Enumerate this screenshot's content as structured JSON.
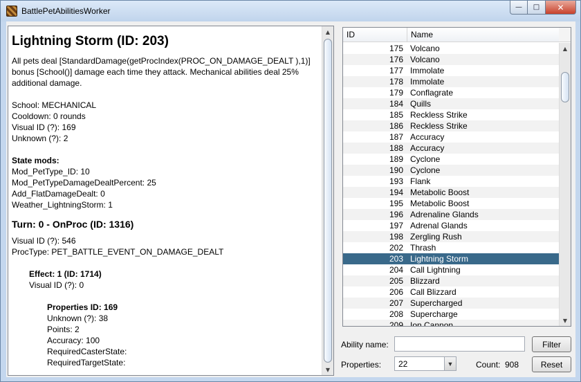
{
  "window": {
    "title": "BattlePetAbilitiesWorker",
    "min_label": "—",
    "max_label": "□",
    "close_label": "✕"
  },
  "description": {
    "title": "Lightning Storm (ID: 203)",
    "summary_lines": [
      "All pets deal [StandardDamage(getProcIndex(PROC_ON_DAMAGE_DEALT ),1)]",
      "bonus [School()] damage each time they attack. Mechanical abilities deal 25%",
      "additional damage."
    ],
    "school": "School: MECHANICAL",
    "cooldown": "Cooldown: 0 rounds",
    "visual_id": "Visual ID (?): 169",
    "unknown": "Unknown (?): 2",
    "state_mods_heading": "State mods:",
    "state_mods": [
      "Mod_PetType_ID: 10",
      "Mod_PetTypeDamageDealtPercent: 25",
      "Add_FlatDamageDealt: 0",
      "Weather_LightningStorm: 1"
    ],
    "turn_heading": "Turn: 0 - OnProc (ID: 1316)",
    "turn_visual_id": "Visual ID (?): 546",
    "proc_type": "ProcType: PET_BATTLE_EVENT_ON_DAMAGE_DEALT",
    "effect_heading": "Effect: 1 (ID: 1714)",
    "effect_visual_id": "Visual ID (?): 0",
    "properties_heading": "Properties ID: 169",
    "properties": [
      "Unknown (?): 38",
      "Points: 2",
      "Accuracy: 100",
      "RequiredCasterState:",
      "RequiredTargetState:"
    ]
  },
  "table": {
    "columns": {
      "id": "ID",
      "name": "Name"
    },
    "rows": [
      {
        "id": "175",
        "name": "Volcano"
      },
      {
        "id": "176",
        "name": "Volcano"
      },
      {
        "id": "177",
        "name": "Immolate"
      },
      {
        "id": "178",
        "name": "Immolate"
      },
      {
        "id": "179",
        "name": "Conflagrate"
      },
      {
        "id": "184",
        "name": "Quills"
      },
      {
        "id": "185",
        "name": "Reckless Strike"
      },
      {
        "id": "186",
        "name": "Reckless Strike"
      },
      {
        "id": "187",
        "name": "Accuracy"
      },
      {
        "id": "188",
        "name": "Accuracy"
      },
      {
        "id": "189",
        "name": "Cyclone"
      },
      {
        "id": "190",
        "name": "Cyclone"
      },
      {
        "id": "193",
        "name": "Flank"
      },
      {
        "id": "194",
        "name": "Metabolic Boost"
      },
      {
        "id": "195",
        "name": "Metabolic Boost"
      },
      {
        "id": "196",
        "name": "Adrenaline Glands"
      },
      {
        "id": "197",
        "name": "Adrenal Glands"
      },
      {
        "id": "198",
        "name": "Zergling Rush"
      },
      {
        "id": "202",
        "name": "Thrash"
      },
      {
        "id": "203",
        "name": "Lightning Storm",
        "selected": true
      },
      {
        "id": "204",
        "name": "Call Lightning"
      },
      {
        "id": "205",
        "name": "Blizzard"
      },
      {
        "id": "206",
        "name": "Call Blizzard"
      },
      {
        "id": "207",
        "name": "Supercharged"
      },
      {
        "id": "208",
        "name": "Supercharge"
      },
      {
        "id": "209",
        "name": "Ion Cannon"
      }
    ],
    "selected_color": "#39698a"
  },
  "form": {
    "ability_name_label": "Ability name:",
    "ability_name_value": "",
    "filter_button": "Filter",
    "properties_label": "Properties:",
    "properties_selected": "22",
    "count_label": "Count:",
    "count_value": "908",
    "reset_button": "Reset"
  }
}
